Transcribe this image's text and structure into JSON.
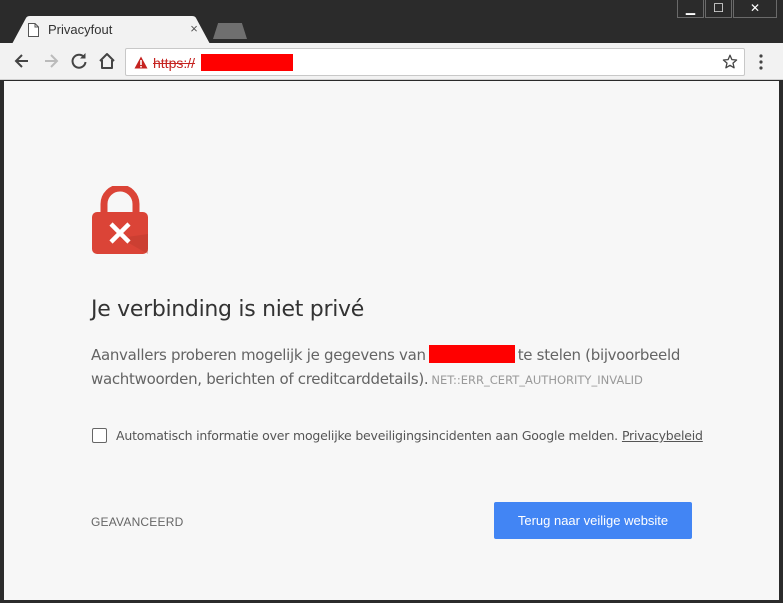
{
  "tab": {
    "title": "Privacyfout",
    "close_glyph": "×"
  },
  "window": {
    "minimize": "▁",
    "maximize": "☐",
    "close": "✕"
  },
  "omnibox": {
    "scheme": "https://",
    "host_redacted": true
  },
  "page": {
    "heading": "Je verbinding is niet privé",
    "desc_before": "Aanvallers proberen mogelijk je gegevens van",
    "desc_after": "te stelen (bijvoorbeeld wachtwoorden, berichten of creditcarddetails).",
    "error_code": "NET::ERR_CERT_AUTHORITY_INVALID",
    "checkbox_label": "Automatisch informatie over mogelijke beveiligingsincidenten aan Google melden.",
    "privacy_link": "Privacybeleid",
    "advanced": "GEAVANCEERD",
    "back_button": "Terug naar veilige website"
  },
  "colors": {
    "primary_button": "#4285f4",
    "lock": "#db4437",
    "redaction": "#ff0000"
  },
  "icons": [
    "document-icon",
    "back-arrow-icon",
    "forward-arrow-icon",
    "reload-icon",
    "home-icon",
    "warning-icon",
    "star-icon",
    "menu-dots-icon",
    "lock-error-icon"
  ]
}
